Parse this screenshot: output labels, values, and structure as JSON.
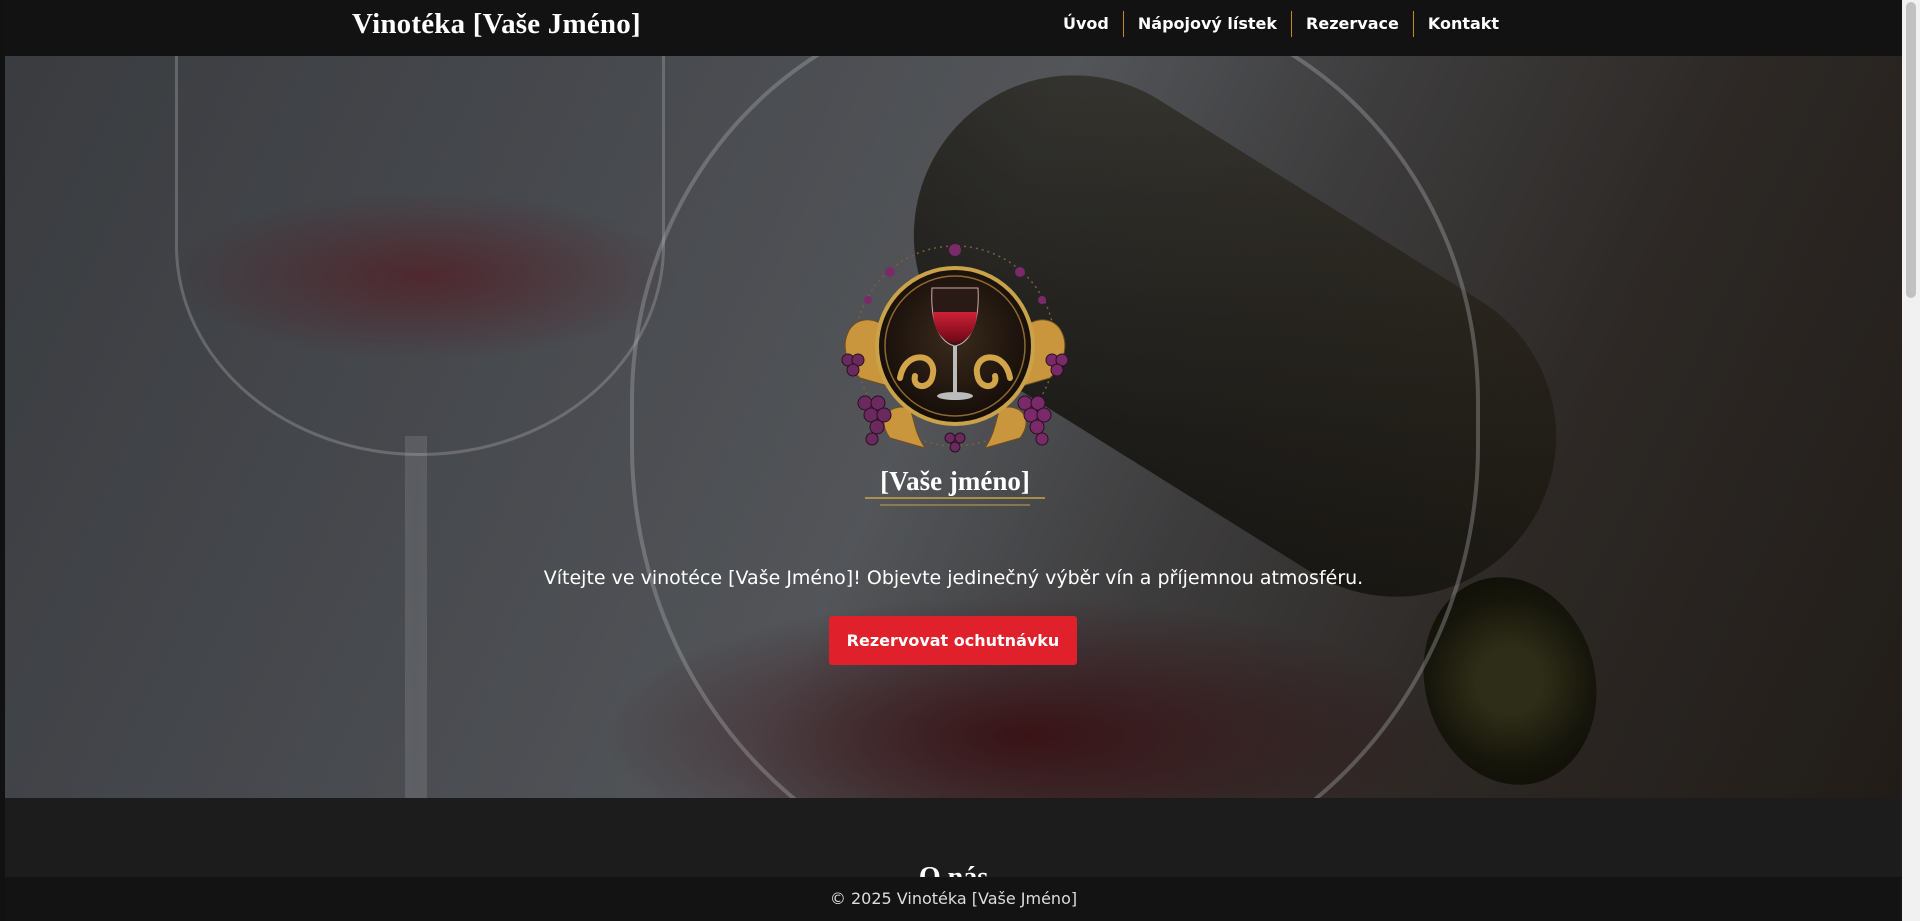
{
  "header": {
    "brand": "Vinotéka [Vaše Jméno]",
    "nav": [
      {
        "label": "Úvod"
      },
      {
        "label": "Nápojový lístek"
      },
      {
        "label": "Rezervace"
      },
      {
        "label": "Kontakt"
      }
    ]
  },
  "hero": {
    "logo_text": "[Vaše jméno]",
    "tagline": "Vítejte ve vinotéce [Vaše Jméno]! Objevte jedinečný výběr vín a příjemnou atmosféru.",
    "cta_label": "Rezervovat ochutnávku"
  },
  "about": {
    "heading": "O nás"
  },
  "footer": {
    "copyright": "© 2025 Vinotéka [Vaše Jméno]"
  },
  "colors": {
    "accent": "#e0202a",
    "nav_separator": "#c48a2a",
    "gold": "#c9a24a",
    "wine": "#8a1020"
  }
}
